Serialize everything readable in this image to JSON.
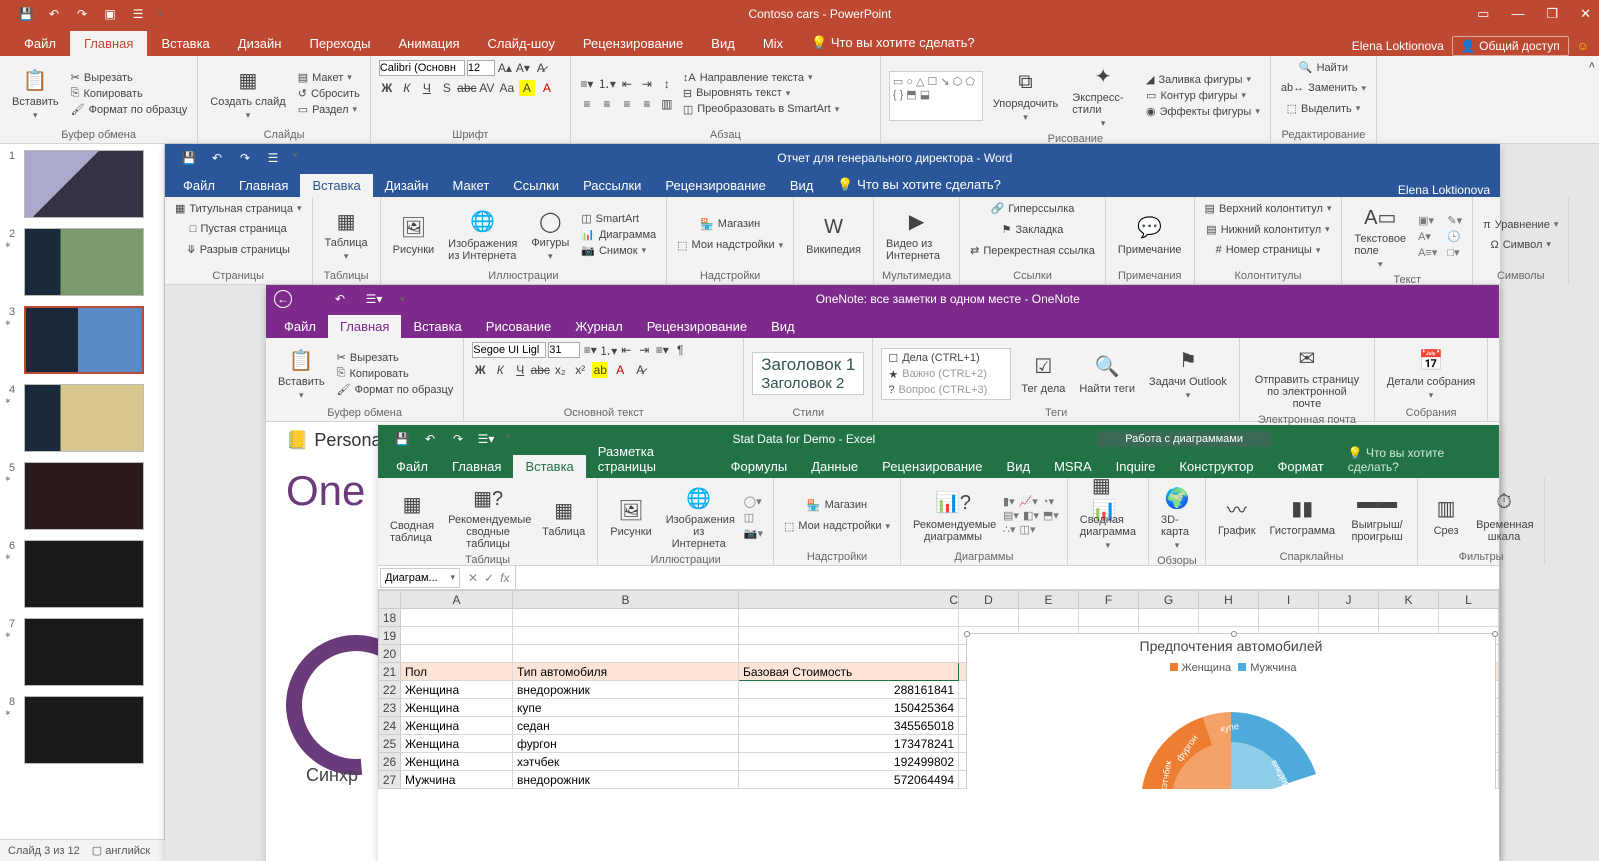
{
  "powerpoint": {
    "title": "Contoso cars - PowerPoint",
    "tabs": [
      "Файл",
      "Главная",
      "Вставка",
      "Дизайн",
      "Переходы",
      "Анимация",
      "Слайд-шоу",
      "Рецензирование",
      "Вид",
      "Mix"
    ],
    "active_tab": 1,
    "tellme": "Что вы хотите сделать?",
    "user": "Elena Loktionova",
    "share": "Общий доступ",
    "ribbon": {
      "paste": "Вставить",
      "cut": "Вырезать",
      "copy": "Копировать",
      "formatpainter": "Формат по образцу",
      "g_clipboard": "Буфер обмена",
      "newslide": "Создать слайд",
      "layout": "Макет",
      "reset": "Сбросить",
      "section": "Раздел",
      "g_slides": "Слайды",
      "font_name": "Calibri (Основн",
      "font_size": "12",
      "g_font": "Шрифт",
      "g_para": "Абзац",
      "textdir": "Направление текста",
      "align": "Выровнять текст",
      "smartart": "Преобразовать в SmartArt",
      "g_draw": "Рисование",
      "arrange": "Упорядочить",
      "qstyles": "Экспресс-стили",
      "shapefill": "Заливка фигуры",
      "shapeoutline": "Контур фигуры",
      "shapeeffects": "Эффекты фигуры",
      "g_edit": "Редактирование",
      "find": "Найти",
      "replace": "Заменить",
      "select": "Выделить"
    },
    "status": {
      "slide": "Слайд 3 из 12",
      "lang": "английск"
    },
    "slides": [
      1,
      2,
      3,
      4,
      5,
      6,
      7,
      8
    ],
    "active_slide": 3
  },
  "word": {
    "title": "Отчет для генерального директора - Word",
    "tabs": [
      "Файл",
      "Главная",
      "Вставка",
      "Дизайн",
      "Макет",
      "Ссылки",
      "Рассылки",
      "Рецензирование",
      "Вид"
    ],
    "active_tab": 2,
    "tellme": "Что вы хотите сделать?",
    "user": "Elena Loktionova",
    "ribbon": {
      "coverpage": "Титульная страница",
      "blankpage": "Пустая страница",
      "pagebreak": "Разрыв страницы",
      "g_pages": "Страницы",
      "table": "Таблица",
      "g_tables": "Таблицы",
      "pictures": "Рисунки",
      "onlinepics": "Изображения из Интернета",
      "shapes": "Фигуры",
      "smartart": "SmartArt",
      "chart": "Диаграмма",
      "screenshot": "Снимок",
      "g_illus": "Иллюстрации",
      "store": "Магазин",
      "myaddins": "Мои надстройки",
      "g_addins": "Надстройки",
      "wikipedia": "Википедия",
      "onlinevideo": "Видео из Интернета",
      "g_media": "Мультимедиа",
      "hyperlink": "Гиперссылка",
      "bookmark": "Закладка",
      "crossref": "Перекрестная ссылка",
      "g_links": "Ссылки",
      "comment": "Примечание",
      "g_comments": "Примечания",
      "header": "Верхний колонтитул",
      "footer": "Нижний колонтитул",
      "pagenum": "Номер страницы",
      "g_hf": "Колонтитулы",
      "textbox": "Текстовое поле",
      "g_text": "Текст",
      "equation": "Уравнение",
      "symbol": "Символ",
      "g_sym": "Символы"
    }
  },
  "onenote": {
    "title": "OneNote: все заметки в одном месте - OneNote",
    "tabs": [
      "Файл",
      "Главная",
      "Вставка",
      "Рисование",
      "Журнал",
      "Рецензирование",
      "Вид"
    ],
    "active_tab": 1,
    "ribbon": {
      "paste": "Вставить",
      "cut": "Вырезать",
      "copy": "Копировать",
      "formatpainter": "Формат по образцу",
      "g_clipboard": "Буфер обмена",
      "font_name": "Segoe UI Ligl",
      "font_size": "31",
      "g_font": "Основной текст",
      "h1": "Заголовок 1",
      "h2": "Заголовок 2",
      "g_styles": "Стили",
      "tag1": "Дела (CTRL+1)",
      "tag2": "Важно (CTRL+2)",
      "tag3": "Вопрос (CTRL+3)",
      "todo": "Тег дела",
      "findtags": "Найти теги",
      "outlooktasks": "Задачи Outlook",
      "g_tags": "Теги",
      "emailpage": "Отправить страницу по электронной почте",
      "g_email": "Электронная почта",
      "meeting": "Детали собрания",
      "g_meet": "Собрания"
    },
    "body": {
      "notebook": "Personal",
      "headline": "One",
      "sync": "Синхр"
    }
  },
  "excel": {
    "title": "Stat Data for Demo - Excel",
    "ctx_title": "Работа с диаграммами",
    "tabs": [
      "Файл",
      "Главная",
      "Вставка",
      "Разметка страницы",
      "Формулы",
      "Данные",
      "Рецензирование",
      "Вид",
      "MSRA",
      "Inquire"
    ],
    "ctx_tabs": [
      "Конструктор",
      "Формат"
    ],
    "active_tab": 2,
    "tellme": "Что вы хотите сделать?",
    "ribbon": {
      "pivot": "Сводная таблица",
      "recpivot": "Рекомендуемые сводные таблицы",
      "table": "Таблица",
      "g_tables": "Таблицы",
      "pictures": "Рисунки",
      "onlinepics": "Изображения из Интернета",
      "g_illus": "Иллюстрации",
      "store": "Магазин",
      "myaddins": "Мои надстройки",
      "g_addins": "Надстройки",
      "reccharts": "Рекомендуемые диаграммы",
      "g_charts": "Диаграммы",
      "pivotchart": "Сводная диаграмма",
      "g_tours": "Обзоры",
      "map3d": "3D-карта",
      "spark_line": "График",
      "spark_col": "Гистограмма",
      "spark_wl": "Выигрыш/проигрыш",
      "g_spark": "Спарклайны",
      "slicer": "Срез",
      "timeline": "Временная шкала",
      "g_filters": "Фильтры"
    },
    "namebox": "Диаграм...",
    "columns": [
      "A",
      "B",
      "C",
      "D",
      "E",
      "F",
      "G",
      "H",
      "I",
      "J",
      "K",
      "L"
    ],
    "rows": [
      {
        "n": 18
      },
      {
        "n": 19
      },
      {
        "n": 20
      },
      {
        "n": 21,
        "hdr": true,
        "a": "Пол",
        "b": "Тип автомобиля",
        "c": "Базовая Стоимость"
      },
      {
        "n": 22,
        "a": "Женщина",
        "b": "внедорожник",
        "c": "288161841"
      },
      {
        "n": 23,
        "a": "Женщина",
        "b": "купе",
        "c": "150425364"
      },
      {
        "n": 24,
        "a": "Женщина",
        "b": "седан",
        "c": "345565018"
      },
      {
        "n": 25,
        "a": "Женщина",
        "b": "фургон",
        "c": "173478241"
      },
      {
        "n": 26,
        "a": "Женщина",
        "b": "хэтчбек",
        "c": "192499802"
      },
      {
        "n": 27,
        "a": "Мужчина",
        "b": "внедорожник",
        "c": "572064494"
      }
    ],
    "chart": {
      "title": "Предпочтения автомобилей",
      "legend": [
        {
          "name": "Женщина",
          "color": "#ED7D31"
        },
        {
          "name": "Мужчина",
          "color": "#4EAADB"
        }
      ],
      "slices": [
        "кэтчбек",
        "фургон",
        "купе",
        "внедоро..."
      ]
    }
  },
  "chart_data": {
    "type": "pie",
    "title": "Предпочтения автомобилей",
    "series": [
      {
        "name": "Женщина",
        "color": "#ED7D31",
        "categories": [
          "внедорожник",
          "купе",
          "седан",
          "фургон",
          "хэтчбек"
        ],
        "values": [
          288161841,
          150425364,
          345565018,
          173478241,
          192499802
        ]
      },
      {
        "name": "Мужчина",
        "color": "#4EAADB",
        "categories": [
          "внедорожник"
        ],
        "values": [
          572064494
        ]
      }
    ]
  }
}
